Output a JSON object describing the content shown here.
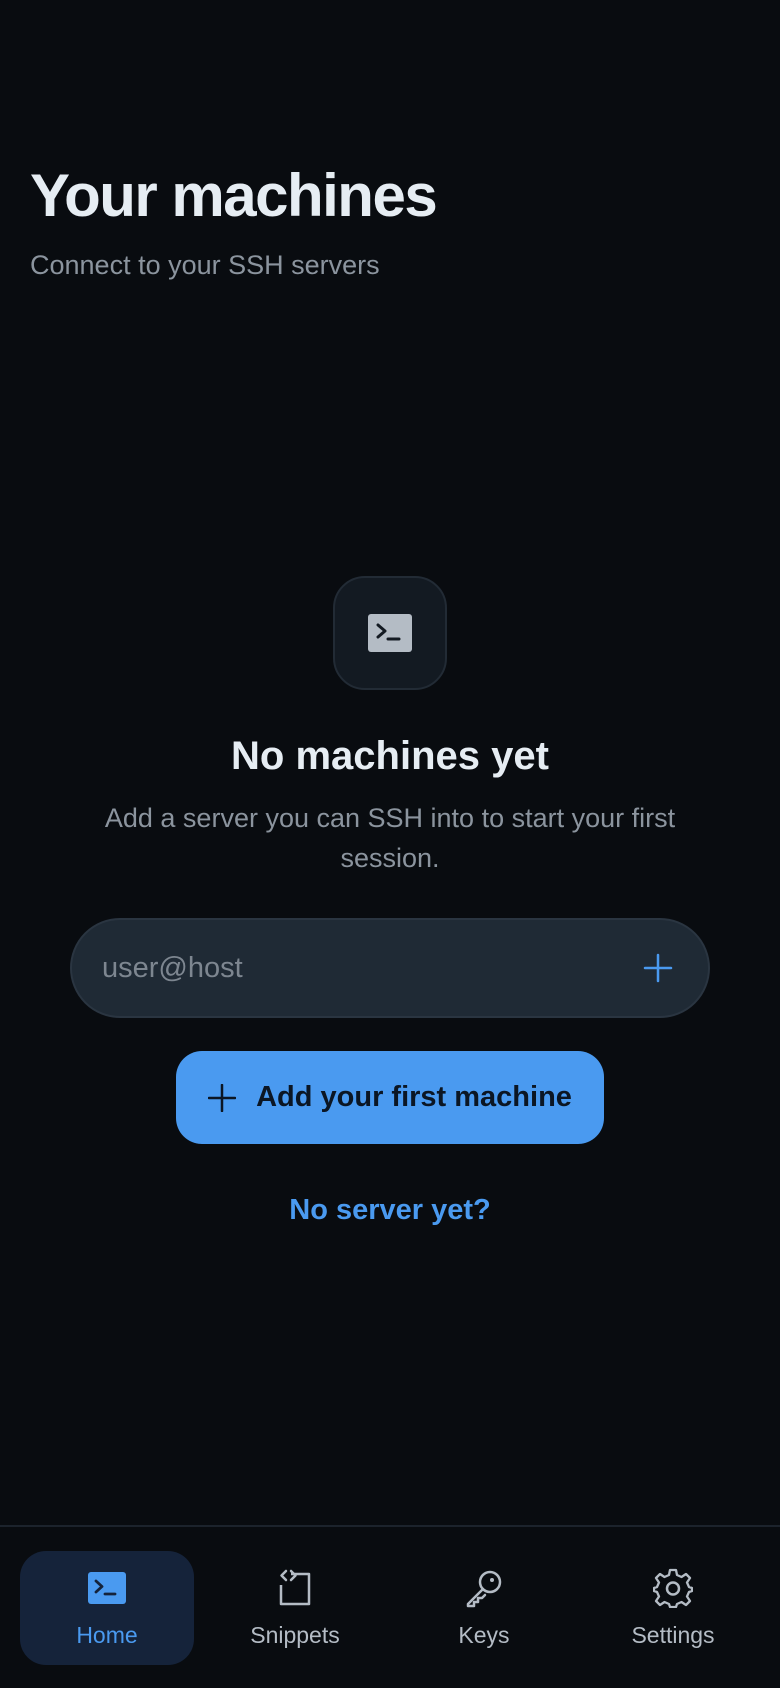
{
  "header": {
    "title": "Your machines",
    "subtitle": "Connect to your SSH servers"
  },
  "empty_state": {
    "icon": "terminal-icon",
    "title": "No machines yet",
    "description": "Add a server you can SSH into to start your first session."
  },
  "host_field": {
    "placeholder": "user@host",
    "value": "",
    "add_icon": "plus-icon"
  },
  "primary_button": {
    "label": "Add your first machine",
    "icon": "plus-icon"
  },
  "help_link": {
    "label": "No server yet?"
  },
  "nav": {
    "items": [
      {
        "label": "Home",
        "icon": "terminal-icon",
        "active": true
      },
      {
        "label": "Snippets",
        "icon": "code-file-icon",
        "active": false
      },
      {
        "label": "Keys",
        "icon": "key-icon",
        "active": false
      },
      {
        "label": "Settings",
        "icon": "gear-icon",
        "active": false
      }
    ]
  },
  "colors": {
    "background": "#090c10",
    "accent": "#4a9af0",
    "text_primary": "#e6edf3",
    "text_secondary": "#8b949e"
  }
}
